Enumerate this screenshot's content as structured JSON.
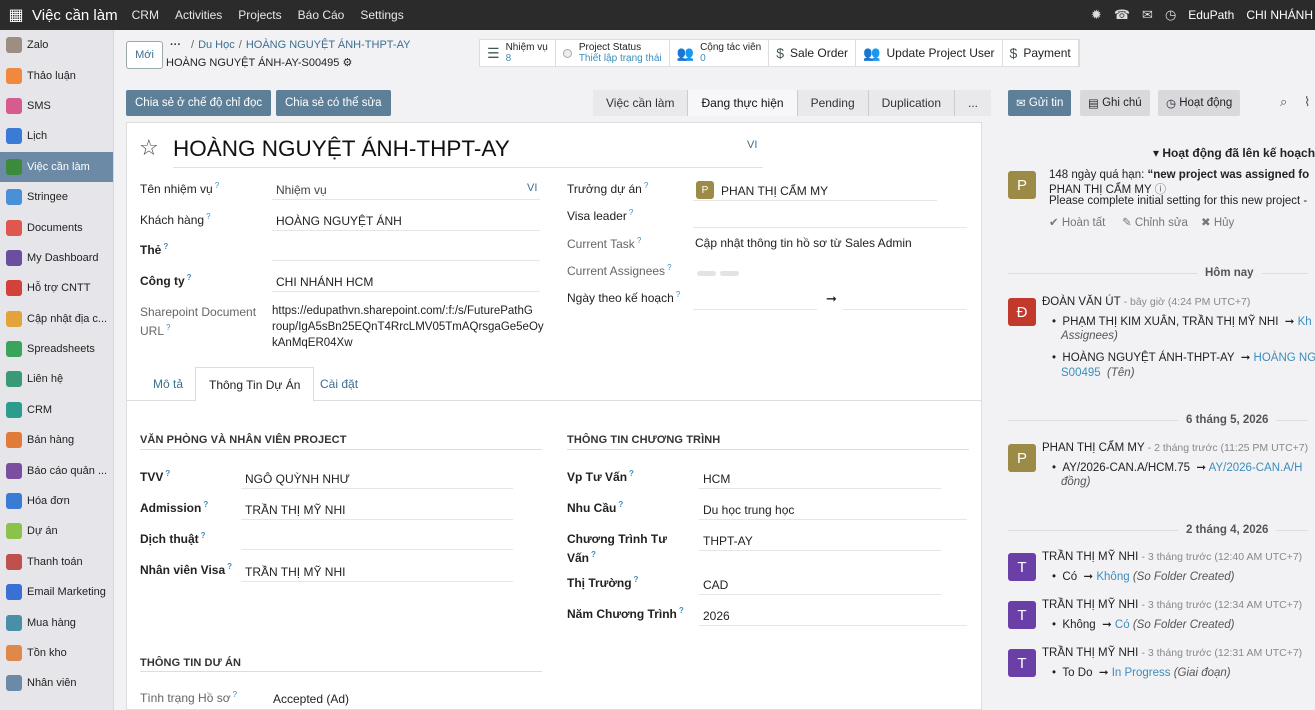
{
  "topbar": {
    "app_name": "Việc cần làm",
    "menus": [
      "CRM",
      "Activities",
      "Projects",
      "Báo Cáo",
      "Settings"
    ],
    "company": "EduPath",
    "branch": "CHI NHÁNH"
  },
  "sidebar": {
    "items": [
      {
        "label": "Zalo",
        "color": "#9c8f82"
      },
      {
        "label": "Thảo luận",
        "color": "#f0883e"
      },
      {
        "label": "SMS",
        "color": "#d65b8f"
      },
      {
        "label": "Lịch",
        "color": "#3a7bd5"
      },
      {
        "label": "Việc cần làm",
        "color": "#3b8a3e"
      },
      {
        "label": "Stringee",
        "color": "#4a90d9"
      },
      {
        "label": "Documents",
        "color": "#e0574f"
      },
      {
        "label": "My Dashboard",
        "color": "#6a4fa0"
      },
      {
        "label": "Hỗ trợ CNTT",
        "color": "#d4403a"
      },
      {
        "label": "Cập nhật địa c...",
        "color": "#e2a33b"
      },
      {
        "label": "Spreadsheets",
        "color": "#3aa35c"
      },
      {
        "label": "Liên hệ",
        "color": "#3b9a76"
      },
      {
        "label": "CRM",
        "color": "#2a9d8f"
      },
      {
        "label": "Bán hàng",
        "color": "#e07b39"
      },
      {
        "label": "Báo cáo quản ...",
        "color": "#7a4fa0"
      },
      {
        "label": "Hóa đơn",
        "color": "#3a7bd5"
      },
      {
        "label": "Dự án",
        "color": "#8bc34a"
      },
      {
        "label": "Thanh toán",
        "color": "#c0504d"
      },
      {
        "label": "Email Marketing",
        "color": "#3a6fd5"
      },
      {
        "label": "Mua hàng",
        "color": "#4a8fa8"
      },
      {
        "label": "Tồn kho",
        "color": "#e0874a"
      },
      {
        "label": "Nhân viên",
        "color": "#6c8aa5"
      }
    ],
    "active_index": 4
  },
  "control": {
    "new_label": "Mới",
    "breadcrumb": [
      "Du Học",
      "HOÀNG NGUYỆT ÁNH-THPT-AY"
    ],
    "record": "HOÀNG NGUYỆT ÁNH-AY-S00495",
    "stats": {
      "tasks_label": "Nhiệm vụ",
      "tasks_value": "8",
      "status_label": "Project Status",
      "status_value": "Thiết lập trạng thái",
      "collab_label": "Cộng tác viên",
      "collab_value": "0",
      "sale_order": "Sale Order",
      "update_user": "Update Project User",
      "payment": "Payment"
    },
    "share_readonly": "Chia sẻ ở chế độ chỉ đọc",
    "share_edit": "Chia sẻ có thể sửa",
    "stages": [
      "Việc cần làm",
      "Đang thực hiện",
      "Pending",
      "Duplication",
      "..."
    ],
    "current_stage": 1
  },
  "form": {
    "title": "HOÀNG NGUYỆT ÁNH-THPT-AY",
    "lang": "VI",
    "task_name_label": "Tên nhiệm vụ",
    "task_name_value": "Nhiệm vụ",
    "customer_label": "Khách hàng",
    "customer_value": "HOÀNG NGUYỆT ÁNH",
    "tags_label": "Thẻ",
    "company_label": "Công ty",
    "company_value": "CHI NHÁNH HCM",
    "sharepoint_label_1": "Sharepoint Document",
    "sharepoint_label_2": "URL",
    "sharepoint_l1": "https://edupathvn.sharepoint.com/:f:/s/FuturePathG",
    "sharepoint_l2": "roup/IgA5sBn25EQnT4RrcLMV05TmAQrsgaGe5eOy",
    "sharepoint_l3": "kAnMqER04Xw",
    "lead_label": "Trưởng dự án",
    "lead_avatar": "P",
    "lead_value": "PHAN THỊ CẨM MY",
    "visa_leader_label": "Visa leader",
    "current_task_label": "Current Task",
    "current_task_value": "Cập nhật thông tin hồ sơ từ Sales Admin",
    "current_assignees_label": "Current Assignees",
    "planned_date_label": "Ngày theo kế hoạch",
    "arrow": "➞"
  },
  "tabs": [
    "Mô tả",
    "Thông Tin Dự Án",
    "Cài đặt"
  ],
  "project_info": {
    "office_section": "VĂN PHÒNG VÀ NHÂN VIÊN PROJECT",
    "tvv_label": "TVV",
    "tvv_value": "NGÔ QUỲNH NHƯ",
    "admission_label": "Admission",
    "admission_value": "TRẦN THỊ MỸ NHI",
    "translate_label": "Dịch thuật",
    "visa_staff_label": "Nhân viên Visa",
    "visa_staff_value": "TRẦN THỊ MỸ NHI",
    "program_section": "THÔNG TIN CHƯƠNG TRÌNH",
    "vp_label": "Vp Tư Vấn",
    "vp_value": "HCM",
    "need_label": "Nhu Cầu",
    "need_value": "Du học trung học",
    "program_label_1": "Chương Trình Tư",
    "program_label_2": "Vấn",
    "program_value": "THPT-AY",
    "market_label": "Thị Trường",
    "market_value": "CAD",
    "year_label": "Năm Chương Trình",
    "year_value": "2026",
    "project_section": "THÔNG TIN DƯ ÁN",
    "status_label": "Tình trạng Hồ sơ",
    "status_value": "Accepted (Ad)"
  },
  "chatter": {
    "send": "Gửi tin",
    "note": "Ghi chú",
    "activity": "Hoạt động",
    "planned": "Hoạt động đã lên kế hoạch",
    "act_overdue": "148 ngày quá hạn:",
    "act_title": "“new project was assigned fo",
    "act_user": "PHAN THỊ CẨM MY",
    "act_desc": "Please complete initial setting for this new project -",
    "act_done": "Hoàn tất",
    "act_edit": "Chỉnh sửa",
    "act_cancel": "Hủy",
    "today": "Hôm nay",
    "m1_author": "ĐOÀN VĂN ÚT",
    "m1_time": "- bây giờ (4:24 PM UTC+7)",
    "m1_l1_old": "PHẠM THỊ KIM XUÂN, TRẦN THỊ MỸ NHI",
    "m1_l1_new": "Kh",
    "m1_l1_field": "Assignees)",
    "m1_l2_old": "HOÀNG NGUYỆT ÁNH-THPT-AY",
    "m1_l2_new": "HOÀNG NG",
    "m1_l2_new2": "S00495",
    "m1_l2_field": "(Tên)",
    "date1": "6 tháng 5, 2026",
    "m2_author": "PHAN THỊ CẨM MY",
    "m2_time": "- 2 tháng trước (11:25 PM UTC+7)",
    "m2_old": "AY/2026-CAN.A/HCM.75",
    "m2_new": "AY/2026-CAN.A/H",
    "m2_field": "đồng)",
    "date2": "2 tháng 4, 2026",
    "m3_author": "TRẦN THỊ MỸ NHI",
    "m3_time": "- 3 tháng trước (12:40 AM UTC+7)",
    "m3_old": "Có",
    "m3_new": "Không",
    "m3_field": "(So Folder Created)",
    "m4_author": "TRẦN THỊ MỸ NHI",
    "m4_time": "- 3 tháng trước (12:34 AM UTC+7)",
    "m4_old": "Không",
    "m4_new": "Có",
    "m4_field": "(So Folder Created)",
    "m5_author": "TRẦN THỊ MỸ NHI",
    "m5_time": "- 3 tháng trước (12:31 AM UTC+7)",
    "m5_old": "To Do",
    "m5_new": "In Progress",
    "m5_field": "(Giai đoạn)"
  }
}
